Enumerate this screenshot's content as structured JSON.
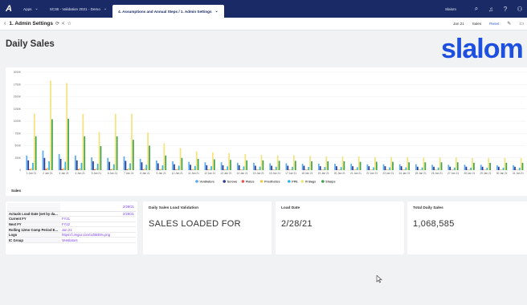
{
  "nav": {
    "logo": "A",
    "tabs": [
      {
        "label": "Apps"
      },
      {
        "label": "SC36 - Validation 2021 - Demo"
      },
      {
        "label": "4. Assumptions and Annual Steps / 1. Admin Settings"
      }
    ],
    "user": "Slalom"
  },
  "titlebar": {
    "title": "1. Admin Settings",
    "period": "Jan 21",
    "sales": "Sales",
    "reset": "Reset"
  },
  "header": {
    "title": "Daily Sales",
    "brand": "slalom"
  },
  "chart_label": "Sales",
  "chart_data": {
    "type": "bar",
    "categories": [
      "1 Jan 21",
      "2 Jan 21",
      "3 Jan 21",
      "4 Jan 21",
      "5 Jan 21",
      "6 Jan 21",
      "7 Jan 21",
      "8 Jan 21",
      "9 Jan 21",
      "10 Jan 21",
      "11 Jan 21",
      "12 Jan 21",
      "13 Jan 21",
      "14 Jan 21",
      "15 Jan 21",
      "16 Jan 21",
      "17 Jan 21",
      "18 Jan 21",
      "19 Jan 21",
      "20 Jan 21",
      "21 Jan 21",
      "22 Jan 21",
      "23 Jan 21",
      "24 Jan 21",
      "25 Jan 21",
      "26 Jan 21",
      "27 Jan 21",
      "28 Jan 21",
      "29 Jan 21",
      "30 Jan 21",
      "31 Jan 21"
    ],
    "y_ticks": [
      "0",
      "250K",
      "500K",
      "750K",
      "1000K",
      "1250K",
      "1500K",
      "1750K",
      "2000K"
    ],
    "ylim": [
      0,
      2000000
    ],
    "series": [
      {
        "name": "Ventilators",
        "color": "#5aaaf0",
        "values": [
          300000,
          400000,
          330000,
          300000,
          260000,
          250000,
          280000,
          230000,
          200000,
          180000,
          170000,
          160000,
          160000,
          150000,
          150000,
          140000,
          140000,
          130000,
          130000,
          130000,
          130000,
          120000,
          120000,
          120000,
          120000,
          110000,
          110000,
          110000,
          110000,
          100000,
          100000
        ]
      },
      {
        "name": "Screws",
        "color": "#2a3b8f",
        "values": [
          200000,
          250000,
          230000,
          200000,
          180000,
          170000,
          190000,
          160000,
          140000,
          120000,
          110000,
          100000,
          100000,
          100000,
          90000,
          90000,
          90000,
          90000,
          80000,
          80000,
          80000,
          80000,
          80000,
          80000,
          70000,
          70000,
          70000,
          70000,
          70000,
          70000,
          70000
        ]
      },
      {
        "name": "Plates",
        "color": "#e8534a",
        "values": [
          20000,
          25000,
          22000,
          20000,
          18000,
          16000,
          18000,
          15000,
          14000,
          12000,
          11000,
          10000,
          10000,
          10000,
          9000,
          9000,
          9000,
          9000,
          8000,
          8000,
          8000,
          8000,
          8000,
          8000,
          7000,
          7000,
          7000,
          7000,
          7000,
          7000,
          7000
        ]
      },
      {
        "name": "Prosthetics",
        "color": "#f2c94c",
        "values": [
          40000,
          50000,
          45000,
          40000,
          35000,
          32000,
          36000,
          30000,
          28000,
          25000,
          22000,
          20000,
          20000,
          19000,
          18000,
          18000,
          17000,
          17000,
          16000,
          16000,
          16000,
          15000,
          15000,
          15000,
          15000,
          14000,
          14000,
          14000,
          14000,
          13000,
          13000
        ]
      },
      {
        "name": "PPE",
        "color": "#35b5e5",
        "values": [
          150000,
          180000,
          170000,
          150000,
          130000,
          120000,
          140000,
          110000,
          100000,
          90000,
          85000,
          80000,
          78000,
          75000,
          72000,
          70000,
          68000,
          66000,
          64000,
          62000,
          60000,
          58000,
          57000,
          56000,
          55000,
          54000,
          53000,
          52000,
          51000,
          50000,
          50000
        ]
      },
      {
        "name": "IV Bags",
        "color": "#f4e27a",
        "values": [
          1150000,
          1830000,
          1780000,
          1150000,
          780000,
          1150000,
          1150000,
          770000,
          550000,
          450000,
          380000,
          360000,
          350000,
          330000,
          310000,
          300000,
          300000,
          290000,
          280000,
          280000,
          280000,
          270000,
          270000,
          270000,
          260000,
          260000,
          260000,
          250000,
          250000,
          250000,
          250000
        ]
      },
      {
        "name": "Sharps",
        "color": "#3fa34d",
        "values": [
          690000,
          1040000,
          1050000,
          690000,
          490000,
          690000,
          620000,
          500000,
          300000,
          250000,
          230000,
          220000,
          210000,
          200000,
          200000,
          190000,
          190000,
          180000,
          180000,
          180000,
          170000,
          170000,
          170000,
          160000,
          160000,
          160000,
          160000,
          150000,
          150000,
          150000,
          150000
        ]
      }
    ]
  },
  "settings_grid": {
    "header_value": "2/28/21",
    "rows": [
      {
        "key": "Actuals Load Date (set by da...",
        "value": "2/28/21"
      },
      {
        "key": "Current FY",
        "value": "FY21"
      },
      {
        "key": "Next FY",
        "value": "FY22"
      },
      {
        "key": "Rolling 12mo Comp Period E...",
        "value": "Jan 21"
      },
      {
        "key": "Logo",
        "value": "https://i.imgur.com/1Zi5tE9n.png"
      },
      {
        "key": "IC Group",
        "value": "Ventilators"
      }
    ]
  },
  "cards": [
    {
      "title": "Daily Sales Load Validation",
      "value": "SALES LOADED FOR"
    },
    {
      "title": "Load Date",
      "value": "2/28/21"
    },
    {
      "title": "Total Daily Sales",
      "value": "1,068,585"
    }
  ]
}
